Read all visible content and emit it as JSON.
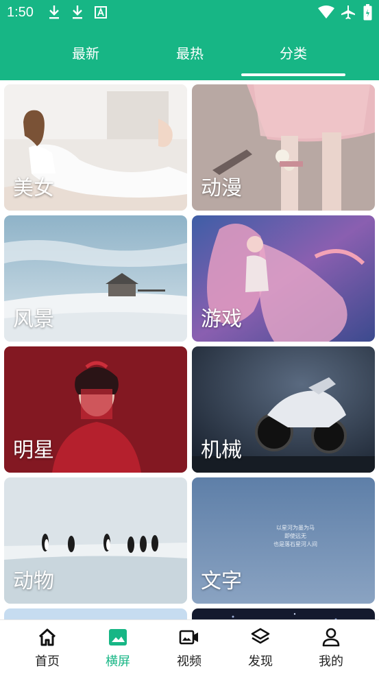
{
  "status": {
    "time": "1:50"
  },
  "tabs": [
    {
      "label": "最新"
    },
    {
      "label": "最热"
    },
    {
      "label": "分类"
    }
  ],
  "active_tab": "分类",
  "categories": [
    {
      "label": "美女"
    },
    {
      "label": "动漫"
    },
    {
      "label": "风景"
    },
    {
      "label": "游戏"
    },
    {
      "label": "明星"
    },
    {
      "label": "机械"
    },
    {
      "label": "动物"
    },
    {
      "label": "文字"
    }
  ],
  "text_card_caption": [
    "以星河为墨为马",
    "即使远无",
    "也是落石星河人间"
  ],
  "bottom_nav": [
    {
      "label": "首页",
      "icon": "home-icon"
    },
    {
      "label": "横屏",
      "icon": "image-icon"
    },
    {
      "label": "视频",
      "icon": "video-camera-icon"
    },
    {
      "label": "发现",
      "icon": "layers-icon"
    },
    {
      "label": "我的",
      "icon": "person-icon"
    }
  ],
  "active_nav": "横屏",
  "colors": {
    "primary": "#17b685",
    "nav_text": "#222222"
  }
}
